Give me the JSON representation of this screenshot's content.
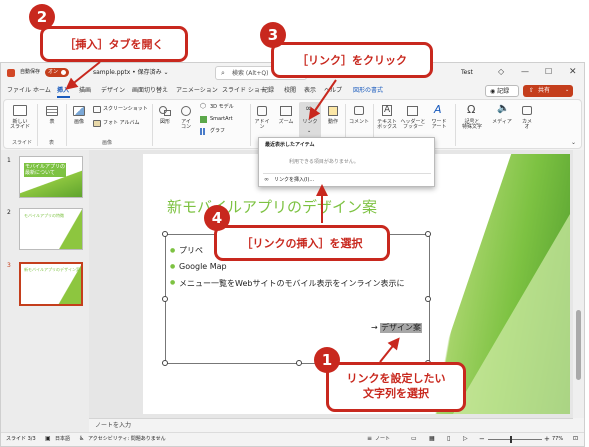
{
  "titlebar": {
    "autosave_label": "自動保存",
    "autosave_state": "オン",
    "file_name": "sample.pptx • 保存済み ⌄",
    "search_placeholder": "検索 (Alt+Q)",
    "user_name": "Test"
  },
  "tabs": [
    {
      "label": "ファイル"
    },
    {
      "label": "ホーム"
    },
    {
      "label": "挿入"
    },
    {
      "label": "描画"
    },
    {
      "label": "デザイン"
    },
    {
      "label": "画面切り替え"
    },
    {
      "label": "アニメーション"
    },
    {
      "label": "スライド ショー"
    },
    {
      "label": "記録"
    },
    {
      "label": "校閲"
    },
    {
      "label": "表示"
    },
    {
      "label": "ヘルプ"
    },
    {
      "label": "図形の書式"
    }
  ],
  "ribbon_right": {
    "record_label": "◉ 記録",
    "share_label": "共有"
  },
  "ribbon": {
    "new_slide": "新しい\nスライド",
    "table": "表",
    "image": "画像",
    "screenshot": "スクリーンショット",
    "photo_album": "フォト アルバム",
    "shapes": "図形",
    "icons": "アイ\nコン",
    "model3d": "3D モデル",
    "smartart": "SmartArt",
    "graph": "グラフ",
    "addin": "アドイ\nン",
    "zoom": "ズーム",
    "link": "リンク",
    "action": "動作",
    "comment": "コメント",
    "textbox": "テキスト\nボックス",
    "header_footer": "ヘッダーと\nフッター",
    "wordart": "ワード\nアート",
    "symbols": "記号と\n特殊文字",
    "media": "メディア",
    "cameo": "カメ\nオ",
    "group_slides": "スライド",
    "group_table": "表",
    "group_images": "画像"
  },
  "link_menu": {
    "header": "最近表示したアイテム",
    "empty": "利用できる項目がありません。",
    "insert": "リンクを挿入(I)..."
  },
  "thumbnails": [
    {
      "num": "1",
      "title": "モバイルアプリの\n最新について"
    },
    {
      "num": "2",
      "title": "モバイルアプリの特徴"
    },
    {
      "num": "3",
      "title": "新モバイルアプリのデザイン案"
    }
  ],
  "slide": {
    "title": "新モバイルアプリのデザイン案",
    "bullets": [
      "プリペ",
      "Google Map",
      "メニュー一覧をWebサイトのモバイル表示をインライン表示に"
    ],
    "link_text_prefix": "→",
    "link_text": "デザイン案"
  },
  "notes_placeholder": "ノートを入力",
  "status": {
    "slide_info": "スライド 3/3",
    "language": "日本語",
    "accessibility": "アクセシビリティ: 問題ありません",
    "notes": "ノート",
    "zoom": "77%"
  },
  "callouts": {
    "c1": "リンクを設定したい\n文字列を選択",
    "c2": "［挿入］タブを開く",
    "c3": "［リンク］をクリック",
    "c4": "［リンクの挿入］を選択",
    "n1": "1",
    "n2": "2",
    "n3": "3",
    "n4": "4"
  },
  "colors": {
    "accent_red": "#c8281e",
    "ppt_orange": "#d24726",
    "slide_green": "#7dc242",
    "share_orange": "#c43e1c",
    "link_blue": "#185abd"
  }
}
